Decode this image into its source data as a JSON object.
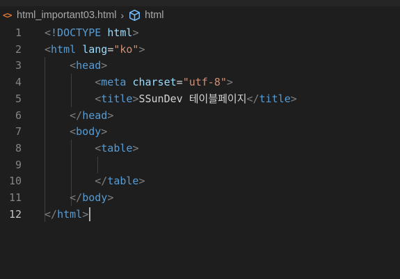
{
  "breadcrumb": {
    "file_icon": "<>",
    "file_name": "html_important03.html",
    "separator": "›",
    "symbol_icon": "cube-symbol-icon",
    "symbol_name": "html"
  },
  "colors": {
    "background": "#1e1e1e",
    "tag": "#569cd6",
    "attribute": "#9cdcfe",
    "string": "#ce9178",
    "punctuation": "#808080",
    "text": "#d4d4d4",
    "line_number": "#858585"
  },
  "editor": {
    "active_line": 12,
    "lines": [
      {
        "n": "1",
        "t": [
          [
            "punct",
            "<"
          ],
          [
            "tag",
            "!DOCTYPE "
          ],
          [
            "attr",
            "html"
          ],
          [
            "punct",
            ">"
          ]
        ]
      },
      {
        "n": "2",
        "t": [
          [
            "punct",
            "<"
          ],
          [
            "tag",
            "html "
          ],
          [
            "attr",
            "lang"
          ],
          [
            "txt",
            "="
          ],
          [
            "str",
            "\"ko\""
          ],
          [
            "punct",
            ">"
          ]
        ]
      },
      {
        "n": "3",
        "t": [
          [
            "txt",
            "    "
          ],
          [
            "punct",
            "<"
          ],
          [
            "tag",
            "head"
          ],
          [
            "punct",
            ">"
          ]
        ]
      },
      {
        "n": "4",
        "t": [
          [
            "txt",
            "        "
          ],
          [
            "punct",
            "<"
          ],
          [
            "tag",
            "meta "
          ],
          [
            "attr",
            "charset"
          ],
          [
            "txt",
            "="
          ],
          [
            "str",
            "\"utf-8\""
          ],
          [
            "punct",
            ">"
          ]
        ]
      },
      {
        "n": "5",
        "t": [
          [
            "txt",
            "        "
          ],
          [
            "punct",
            "<"
          ],
          [
            "tag",
            "title"
          ],
          [
            "punct",
            ">"
          ],
          [
            "txt",
            "SSunDev "
          ],
          [
            "kor",
            "테이블페이지"
          ],
          [
            "punct",
            "</"
          ],
          [
            "tag",
            "title"
          ],
          [
            "punct",
            ">"
          ]
        ]
      },
      {
        "n": "6",
        "t": [
          [
            "txt",
            "    "
          ],
          [
            "punct",
            "</"
          ],
          [
            "tag",
            "head"
          ],
          [
            "punct",
            ">"
          ]
        ]
      },
      {
        "n": "7",
        "t": [
          [
            "txt",
            "    "
          ],
          [
            "punct",
            "<"
          ],
          [
            "tag",
            "body"
          ],
          [
            "punct",
            ">"
          ]
        ]
      },
      {
        "n": "8",
        "t": [
          [
            "txt",
            "        "
          ],
          [
            "punct",
            "<"
          ],
          [
            "tag",
            "table"
          ],
          [
            "punct",
            ">"
          ]
        ]
      },
      {
        "n": "9",
        "t": []
      },
      {
        "n": "10",
        "t": [
          [
            "txt",
            "        "
          ],
          [
            "punct",
            "</"
          ],
          [
            "tag",
            "table"
          ],
          [
            "punct",
            ">"
          ]
        ]
      },
      {
        "n": "11",
        "t": [
          [
            "txt",
            "    "
          ],
          [
            "punct",
            "</"
          ],
          [
            "tag",
            "body"
          ],
          [
            "punct",
            ">"
          ]
        ]
      },
      {
        "n": "12",
        "t": [
          [
            "punct",
            "</"
          ],
          [
            "tag",
            "html"
          ],
          [
            "punct",
            ">"
          ]
        ]
      }
    ]
  }
}
